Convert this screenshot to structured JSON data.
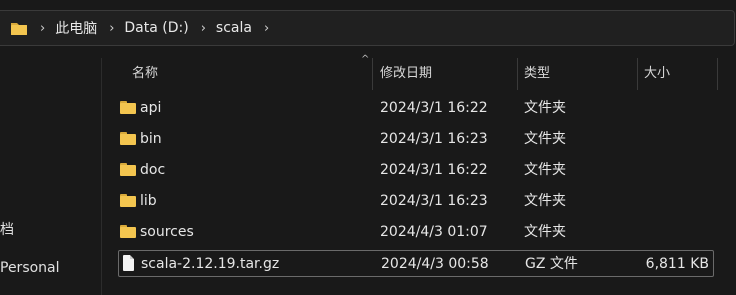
{
  "breadcrumb": {
    "items": [
      "此电脑",
      "Data (D:)",
      "scala"
    ]
  },
  "sidebar": {
    "items": [
      "档",
      "Personal"
    ]
  },
  "columns": {
    "name": "名称",
    "date": "修改日期",
    "type": "类型",
    "size": "大小"
  },
  "files": [
    {
      "name": "api",
      "date": "2024/3/1 16:22",
      "type": "文件夹",
      "size": "",
      "kind": "folder"
    },
    {
      "name": "bin",
      "date": "2024/3/1 16:23",
      "type": "文件夹",
      "size": "",
      "kind": "folder"
    },
    {
      "name": "doc",
      "date": "2024/3/1 16:22",
      "type": "文件夹",
      "size": "",
      "kind": "folder"
    },
    {
      "name": "lib",
      "date": "2024/3/1 16:23",
      "type": "文件夹",
      "size": "",
      "kind": "folder"
    },
    {
      "name": "sources",
      "date": "2024/4/3 01:07",
      "type": "文件夹",
      "size": "",
      "kind": "folder"
    },
    {
      "name": "scala-2.12.19.tar.gz",
      "date": "2024/4/3 00:58",
      "type": "GZ 文件",
      "size": "6,811 KB",
      "kind": "file"
    }
  ],
  "icons": {
    "address": "folder-icon",
    "separator": "chevron-right-icon",
    "folder": "folder-icon",
    "file": "file-icon",
    "sort": "sort-up-icon"
  },
  "colors": {
    "background": "#191919",
    "folder": "#f3c54f",
    "text": "#e6e6e6"
  }
}
